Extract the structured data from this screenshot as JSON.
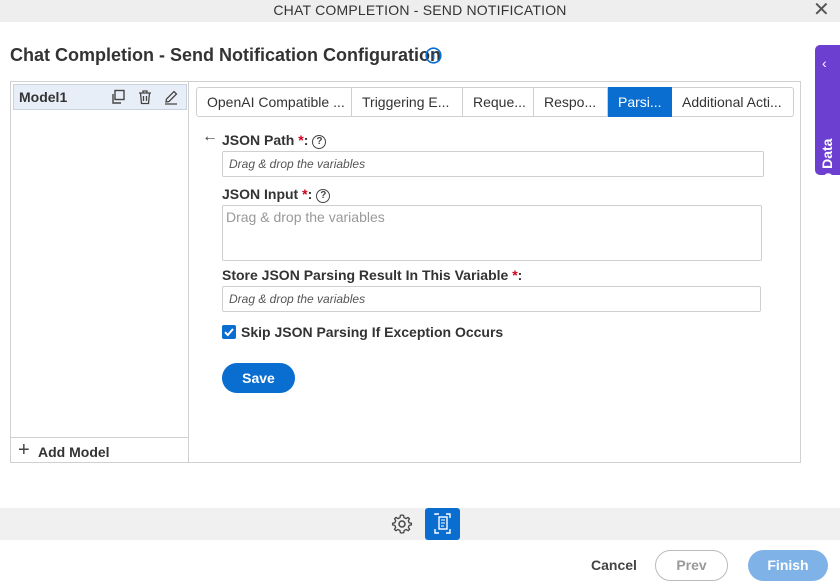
{
  "window": {
    "title": "CHAT COMPLETION - SEND NOTIFICATION",
    "close_glyph": "✕"
  },
  "page": {
    "title": "Chat Completion - Send Notification Configuration"
  },
  "app_data_tab": {
    "label": "App Data",
    "chevron": "‹"
  },
  "models": {
    "items": [
      {
        "label": "Model1"
      }
    ],
    "add_label": "Add Model"
  },
  "tabs": [
    {
      "label": "OpenAI Compatible ...",
      "active": false
    },
    {
      "label": "Triggering E...",
      "active": false
    },
    {
      "label": "Reque...",
      "active": false
    },
    {
      "label": "Respo...",
      "active": false
    },
    {
      "label": "Parsi...",
      "active": true
    },
    {
      "label": "Additional Acti...",
      "active": false
    }
  ],
  "form": {
    "json_path": {
      "label": "JSON Path",
      "required": "*",
      "suffix": ":",
      "placeholder": "Drag & drop the variables"
    },
    "json_input": {
      "label": "JSON Input",
      "required": "*",
      "suffix": ":",
      "placeholder": "Drag & drop the variables"
    },
    "store_result": {
      "label": "Store JSON Parsing Result In This Variable",
      "required": "*",
      "suffix": ":",
      "placeholder": "Drag & drop the variables"
    },
    "skip_exception": {
      "label": "Skip JSON Parsing If Exception Occurs",
      "checked": true
    },
    "save_label": "Save"
  },
  "footer": {
    "cancel_label": "Cancel",
    "prev_label": "Prev",
    "finish_label": "Finish"
  },
  "colors": {
    "primary": "#0a6ed1",
    "app_data": "#6c3fd1",
    "required": "#d0021b"
  }
}
